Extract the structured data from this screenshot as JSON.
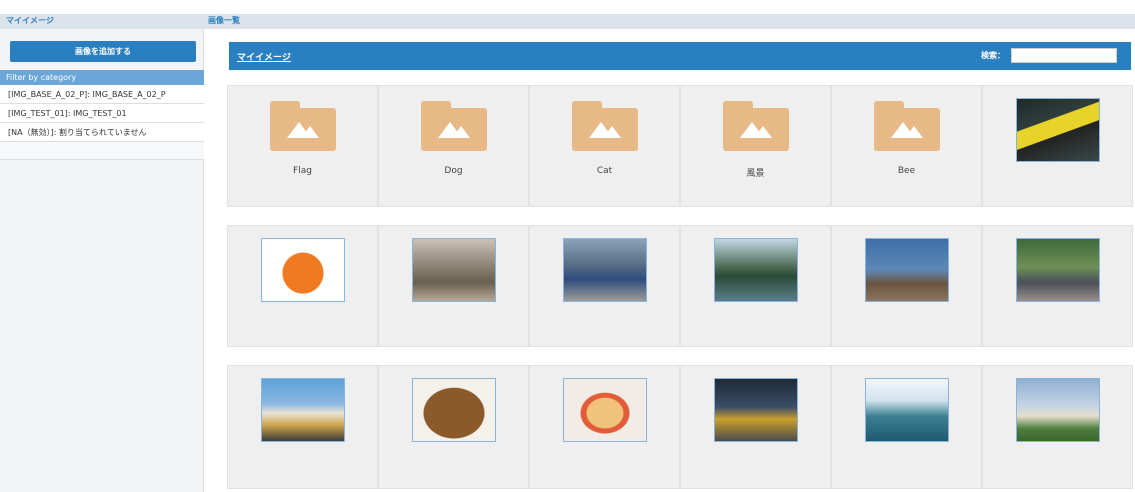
{
  "header": {
    "left_title": "マイイメージ",
    "right_title": "画像一覧"
  },
  "sidebar": {
    "add_button": "画像を追加する",
    "filter_heading": "Filter by category",
    "filters": [
      "[IMG_BASE_A_02_P]: IMG_BASE_A_02_P",
      "[IMG_TEST_01]: IMG_TEST_01",
      "[NA（無効）]: 割り当てられていません"
    ]
  },
  "main": {
    "panel_title": "マイイメージ",
    "search_label": "検索：",
    "search_value": "",
    "folders": [
      "Flag",
      "Dog",
      "Cat",
      "風景",
      "Bee"
    ]
  },
  "colors": {
    "accent": "#2a7fc0",
    "filter_heading_bg": "#6aa6d8",
    "folder": "#e7b987",
    "cell_bg": "#efefef"
  }
}
